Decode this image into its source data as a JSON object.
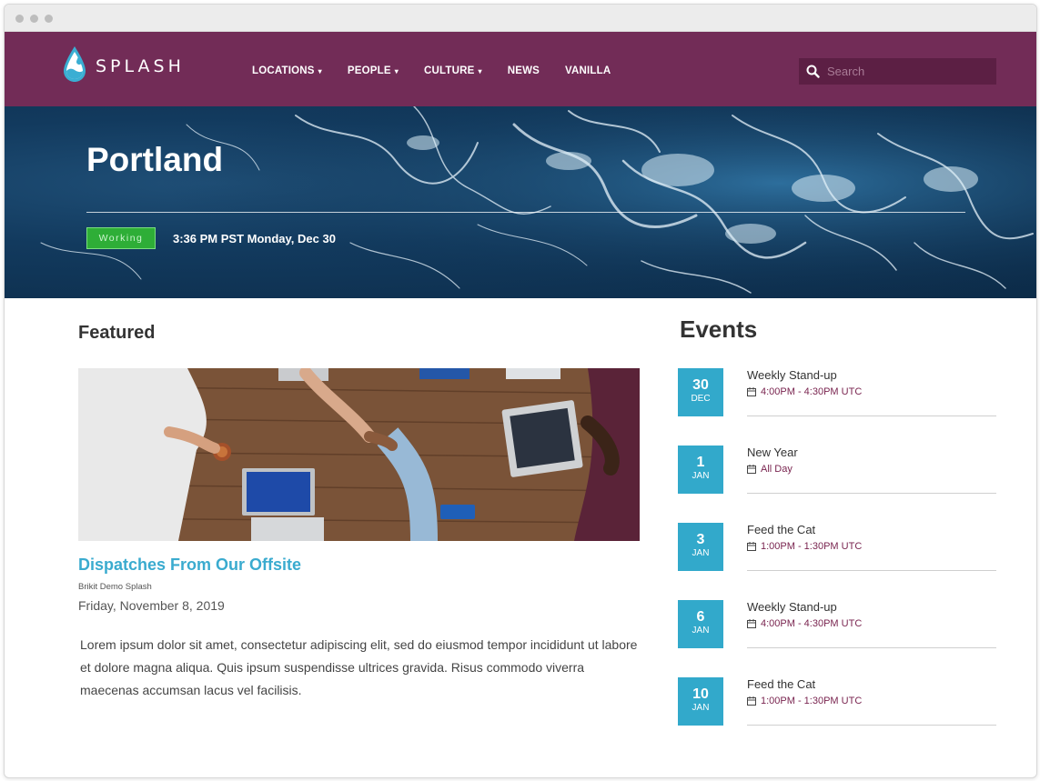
{
  "brand": {
    "name": "SPLASH",
    "color": "#722c57",
    "accent": "#32a9cb"
  },
  "nav": {
    "items": [
      {
        "label": "LOCATIONS",
        "has_dropdown": true
      },
      {
        "label": "PEOPLE",
        "has_dropdown": true
      },
      {
        "label": "CULTURE",
        "has_dropdown": true
      },
      {
        "label": "NEWS",
        "has_dropdown": false
      },
      {
        "label": "VANILLA",
        "has_dropdown": false
      }
    ],
    "search_placeholder": "Search",
    "caret": "▾"
  },
  "hero": {
    "title": "Portland",
    "status": "Working",
    "status_color": "#2eae37",
    "time": "3:36 PM PST Monday, Dec 30"
  },
  "featured": {
    "heading": "Featured",
    "title": "Dispatches From Our Offsite",
    "author": "Brikit Demo Splash",
    "date": "Friday, November 8, 2019",
    "body": "Lorem ipsum dolor sit amet, consectetur adipiscing elit, sed do eiusmod tempor incididunt ut labore et dolore magna aliqua. Quis ipsum suspendisse ultrices gravida. Risus commodo viverra maecenas accumsan lacus vel facilisis."
  },
  "events": {
    "heading": "Events",
    "items": [
      {
        "day": "30",
        "month": "DEC",
        "title": "Weekly Stand-up",
        "time": "4:00PM - 4:30PM UTC"
      },
      {
        "day": "1",
        "month": "JAN",
        "title": "New Year",
        "time": "All Day"
      },
      {
        "day": "3",
        "month": "JAN",
        "title": "Feed the Cat",
        "time": "1:00PM - 1:30PM UTC"
      },
      {
        "day": "6",
        "month": "JAN",
        "title": "Weekly Stand-up",
        "time": "4:00PM - 4:30PM UTC"
      },
      {
        "day": "10",
        "month": "JAN",
        "title": "Feed the Cat",
        "time": "1:00PM - 1:30PM UTC"
      }
    ]
  }
}
